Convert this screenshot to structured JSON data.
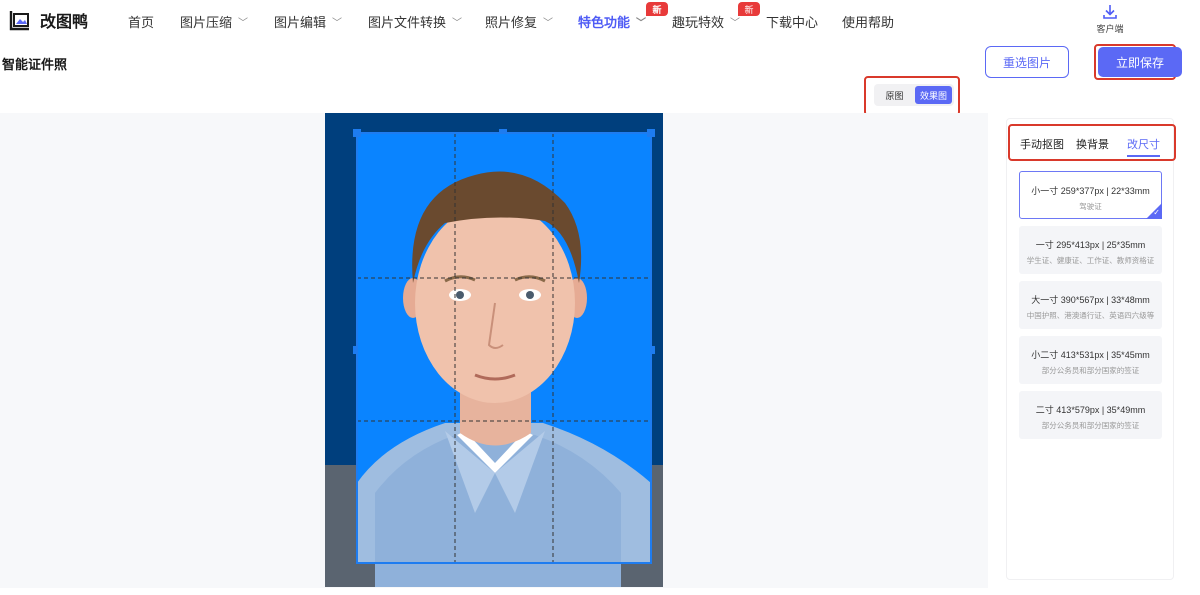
{
  "app": {
    "name": "改图鸭"
  },
  "nav": [
    {
      "label": "首页",
      "dropdown": false
    },
    {
      "label": "图片压缩",
      "dropdown": true
    },
    {
      "label": "图片编辑",
      "dropdown": true
    },
    {
      "label": "图片文件转换",
      "dropdown": true
    },
    {
      "label": "照片修复",
      "dropdown": true
    },
    {
      "label": "特色功能",
      "dropdown": true,
      "active": true,
      "badge": "新"
    },
    {
      "label": "趣玩特效",
      "dropdown": true,
      "badge": "新"
    },
    {
      "label": "下载中心",
      "dropdown": false
    },
    {
      "label": "使用帮助",
      "dropdown": false
    }
  ],
  "client": {
    "label": "客户端",
    "icon": "download-icon"
  },
  "page": {
    "title": "智能证件照"
  },
  "actions": {
    "reselect": "重选图片",
    "save": "立即保存"
  },
  "view_toggle": {
    "original": "原图",
    "result": "效果图",
    "selected": "效果图"
  },
  "panel": {
    "tabs": [
      {
        "label": "手动抠图"
      },
      {
        "label": "换背景"
      },
      {
        "label": "改尺寸",
        "active": true
      }
    ],
    "sizes": [
      {
        "title": "小一寸 259*377px | 22*33mm",
        "desc": "驾驶证",
        "selected": true
      },
      {
        "title": "一寸 295*413px | 25*35mm",
        "desc": "学生证、健康证、工作证、教师资格证"
      },
      {
        "title": "大一寸 390*567px | 33*48mm",
        "desc": "中国护照、港澳通行证、英语四六级等"
      },
      {
        "title": "小二寸 413*531px | 35*45mm",
        "desc": "部分公务员和部分国家的签证"
      },
      {
        "title": "二寸 413*579px | 35*49mm",
        "desc": "部分公务员和部分国家的签证"
      }
    ]
  },
  "colors": {
    "accent": "#5b69f5",
    "highlight_box": "#d9392b",
    "photo_bg": "#0a84ff",
    "new_badge": "#e83a3a"
  }
}
